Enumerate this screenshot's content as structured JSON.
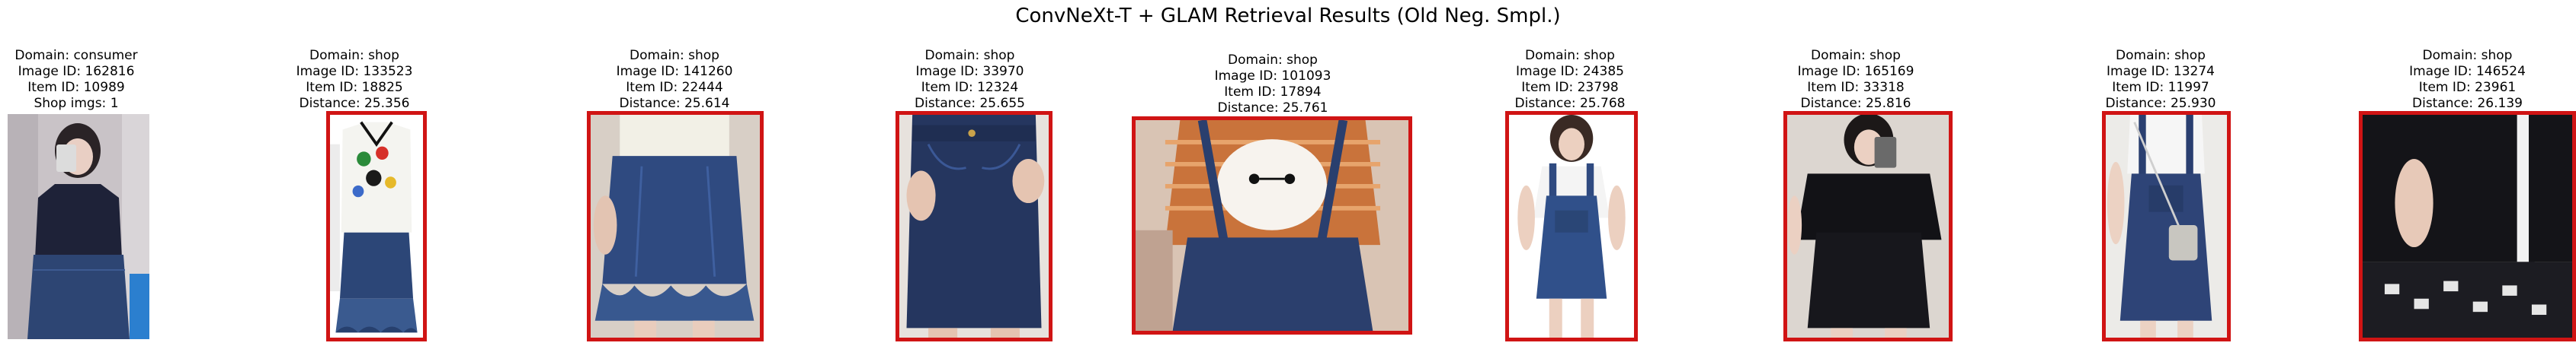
{
  "figure": {
    "title": "ConvNeXt-T + GLAM Retrieval Results (Old Neg. Smpl.)"
  },
  "query": {
    "domain": "Domain: consumer",
    "image_id": "Image ID: 162816",
    "item_id": "Item ID: 10989",
    "shop_imgs": "Shop imgs: 1",
    "image_description": "consumer mirror selfie, navy sleeveless top with denim skirt"
  },
  "results": [
    {
      "domain": "Domain: shop",
      "image_id": "Image ID: 133523",
      "item_id": "Item ID: 18825",
      "distance": "Distance: 25.356",
      "image_description": "white graphic top with denim ruffle skirt",
      "match": "incorrect"
    },
    {
      "domain": "Domain: shop",
      "image_id": "Image ID: 141260",
      "item_id": "Item ID: 22444",
      "distance": "Distance: 25.614",
      "image_description": "denim ruffle-hem skirt close-up",
      "match": "incorrect"
    },
    {
      "domain": "Domain: shop",
      "image_id": "Image ID: 33970",
      "item_id": "Item ID: 12324",
      "distance": "Distance: 25.655",
      "image_description": "dark denim pencil skirt close-up",
      "match": "incorrect"
    },
    {
      "domain": "Domain: shop",
      "image_id": "Image ID: 101093",
      "item_id": "Item ID: 17894",
      "distance": "Distance: 25.761",
      "image_description": "striped cartoon tee with denim overall dress",
      "match": "incorrect"
    },
    {
      "domain": "Domain: shop",
      "image_id": "Image ID: 24385",
      "item_id": "Item ID: 23798",
      "distance": "Distance: 25.768",
      "image_description": "denim overall dress with white tee",
      "match": "incorrect"
    },
    {
      "domain": "Domain: shop",
      "image_id": "Image ID: 165169",
      "item_id": "Item ID: 33318",
      "distance": "Distance: 25.816",
      "image_description": "black tee with black skirt mirror selfie",
      "match": "incorrect"
    },
    {
      "domain": "Domain: shop",
      "image_id": "Image ID: 13274",
      "item_id": "Item ID: 11997",
      "distance": "Distance: 25.930",
      "image_description": "denim overall dress with crossbody bag",
      "match": "incorrect"
    },
    {
      "domain": "Domain: shop",
      "image_id": "Image ID: 146524",
      "item_id": "Item ID: 23961",
      "distance": "Distance: 26.139",
      "image_description": "black tee with patterned shorts",
      "match": "incorrect"
    }
  ],
  "colors": {
    "incorrect_border": "#d01414",
    "denim": "#2e4679",
    "dark": "#15151a"
  }
}
